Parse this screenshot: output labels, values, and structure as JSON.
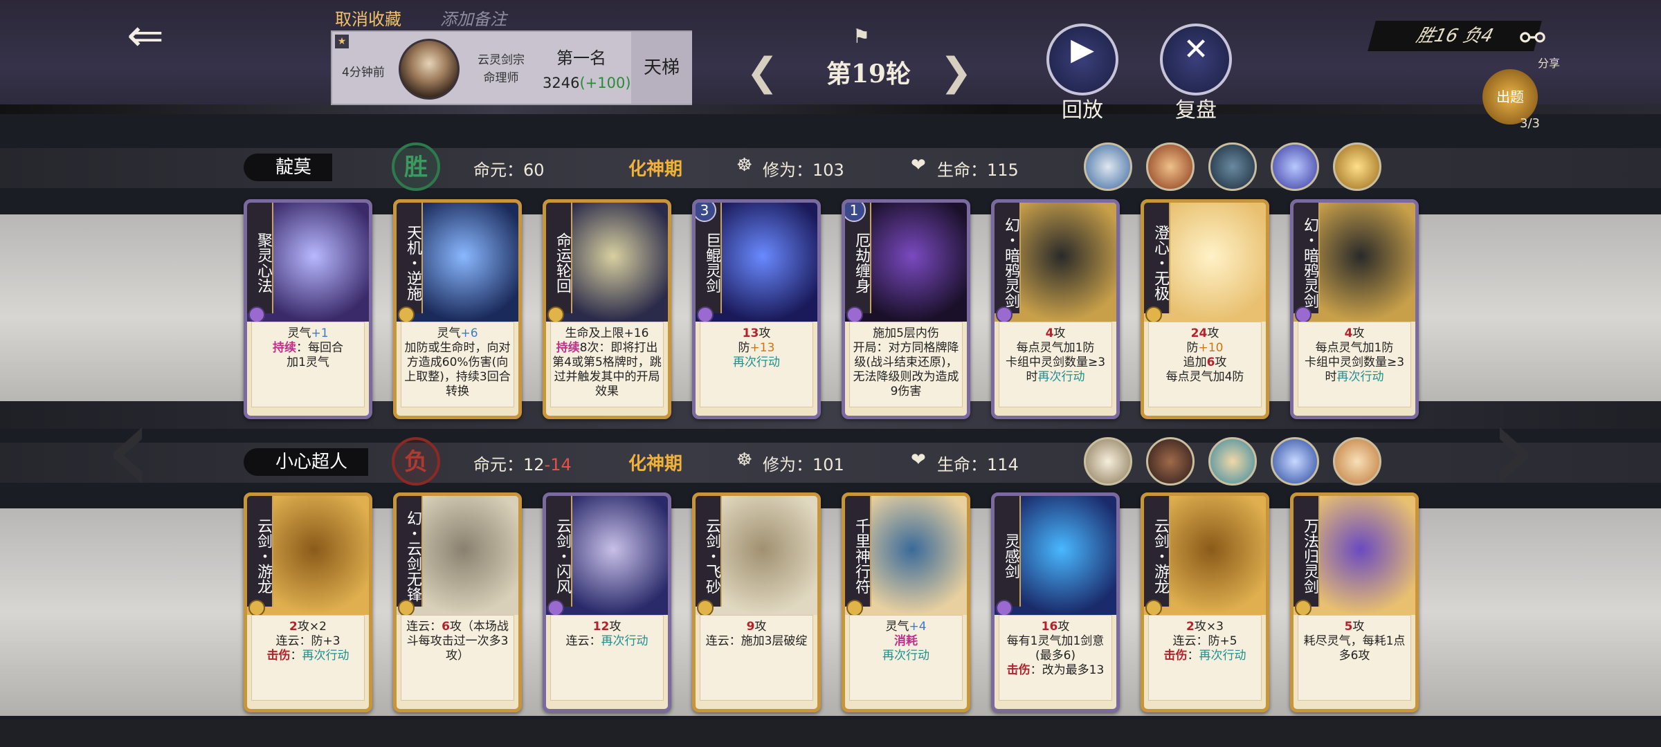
{
  "header": {
    "cancel_favorite": "取消收藏",
    "add_note": "添加备注",
    "player": {
      "time_ago": "4分钟前",
      "sect": "云灵剑宗",
      "role": "命理师",
      "rank_title": "第一名",
      "score": "3246",
      "score_delta": "(+100)",
      "ladder": "天梯"
    },
    "round_label": "第19轮",
    "replay_label": "回放",
    "review_label": "复盘",
    "record": "胜16  负4",
    "share_label": "分享",
    "quiz_label": "出题",
    "quiz_count": "3/3"
  },
  "players": [
    {
      "name": "靛莫",
      "result": "胜",
      "destiny_label": "命元：",
      "destiny": "60",
      "destiny_extra": "",
      "realm": "化神期",
      "cultivation_label": "修为：",
      "cultivation": "103",
      "life_label": "生命：",
      "life": "115",
      "cards": [
        {
          "name": "聚灵心法",
          "style": "purple",
          "level": "",
          "desc_html": "灵气<span class='blue'>+1</span><br><span class='pink'>持续</span>：每回合<br>加1灵气"
        },
        {
          "name": "天机・逆施",
          "style": "gold",
          "level": "",
          "desc_html": "灵气<span class='blue'>+6</span><br>加防或生命时，向对方造成60%伤害(向上取整)，持续3回合<br>转换"
        },
        {
          "name": "命运轮回",
          "style": "gold",
          "level": "",
          "desc_html": "生命及上限+16<br><span class='pink'>持续</span>8次：即将打出第4或第5格牌时，跳过并触发其中的开局效果"
        },
        {
          "name": "巨鲲灵剑",
          "style": "purple",
          "level": "3",
          "desc_html": "<span class='red'>13</span>攻<br>防<span class='orange'>+13</span><br><span class='cyan'>再次行动</span>"
        },
        {
          "name": "厄劫缠身",
          "style": "purple",
          "level": "1",
          "desc_html": "施加5层内伤<br>开局：对方同格牌降级(战斗结束还原)，无法降级则改为造成9伤害"
        },
        {
          "name": "幻・暗鸦灵剑",
          "style": "purple",
          "level": "",
          "desc_html": "<span class='red'>4</span>攻<br>每点灵气加1防<br>卡组中灵剑数量≥3时<span class='cyan'>再次行动</span>"
        },
        {
          "name": "澄心・无极",
          "style": "gold",
          "level": "",
          "desc_html": "<span class='red'>24</span>攻<br>防<span class='orange'>+10</span><br>追加<span class='red'>6</span>攻<br>每点灵气加4防"
        },
        {
          "name": "幻・暗鸦灵剑",
          "style": "purple",
          "level": "",
          "desc_html": "<span class='red'>4</span>攻<br>每点灵气加1防<br>卡组中灵剑数量≥3时<span class='cyan'>再次行动</span>"
        }
      ]
    },
    {
      "name": "小心超人",
      "result": "负",
      "destiny_label": "命元：",
      "destiny": "12",
      "destiny_extra": "-14",
      "realm": "化神期",
      "cultivation_label": "修为：",
      "cultivation": "101",
      "life_label": "生命：",
      "life": "114",
      "cards": [
        {
          "name": "云剑・游龙",
          "style": "gold",
          "level": "",
          "desc_html": "<span class='red'>2</span>攻×2<br>连云：防+3<br><span class='red'>击伤</span>：<span class='cyan'>再次行动</span>"
        },
        {
          "name": "幻・云剑无锋",
          "style": "gold",
          "level": "",
          "desc_html": "连云：<span class='red'>6</span>攻（本场战斗每攻击过一次多3攻）"
        },
        {
          "name": "云剑・闪风",
          "style": "purple",
          "level": "",
          "desc_html": "<span class='red'>12</span>攻<br>连云：<span class='cyan'>再次行动</span>"
        },
        {
          "name": "云剑・飞砂",
          "style": "gold",
          "level": "",
          "desc_html": "<span class='red'>9</span>攻<br>连云：施加3层破绽"
        },
        {
          "name": "千里神行符",
          "style": "gold",
          "level": "",
          "desc_html": "灵气<span class='blue'>+4</span><br><span class='pink'>消耗</span><br><span class='cyan'>再次行动</span>"
        },
        {
          "name": "灵感剑",
          "style": "purple",
          "level": "",
          "desc_html": "<span class='red'>16</span>攻<br>每有1灵气加1剑意(最多6)<br><span class='red'>击伤</span>：改为最多13"
        },
        {
          "name": "云剑・游龙",
          "style": "gold",
          "level": "",
          "desc_html": "<span class='red'>2</span>攻×3<br>连云：防+5<br><span class='red'>击伤</span>：<span class='cyan'>再次行动</span>"
        },
        {
          "name": "万法归灵剑",
          "style": "gold",
          "level": "",
          "desc_html": "<span class='red'>5</span>攻<br>耗尽灵气，每耗1点多6攻"
        }
      ]
    }
  ],
  "colors": {
    "accent_gold": "#f0b23a",
    "win_green": "#3c9a5e",
    "lose_red": "#b03a30"
  },
  "icons": [
    "back-arrow-icon",
    "flag-icon",
    "play-icon",
    "crossed-swords-icon",
    "share-icon",
    "meditation-icon",
    "heart-icon"
  ]
}
